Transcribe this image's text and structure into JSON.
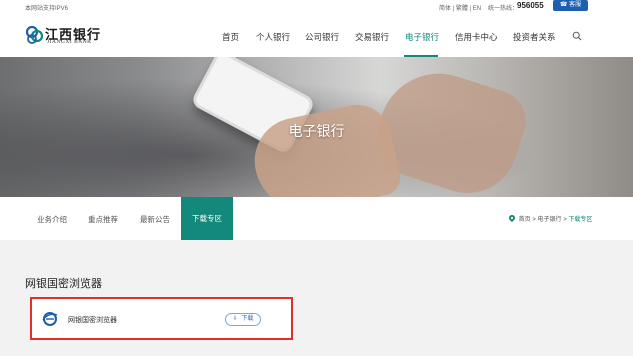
{
  "topbar": {
    "ipv6": "本网站支持IPV6",
    "lang": "简体 | 繁體 | EN",
    "hotline_label": "统一热线：",
    "hotline_number": "956055",
    "cs_label": "客服"
  },
  "logo": {
    "cn": "江西银行",
    "en": "JIANGXI BANK"
  },
  "nav": {
    "items": [
      {
        "label": "首页"
      },
      {
        "label": "个人银行"
      },
      {
        "label": "公司银行"
      },
      {
        "label": "交易银行"
      },
      {
        "label": "电子银行"
      },
      {
        "label": "信用卡中心"
      },
      {
        "label": "投资者关系"
      }
    ],
    "active": "电子银行",
    "icons": {
      "search": "search-icon"
    }
  },
  "hero": {
    "title": "电子银行"
  },
  "subnav": {
    "items": [
      {
        "label": "业务介绍"
      },
      {
        "label": "重点推荐"
      },
      {
        "label": "最新公告"
      },
      {
        "label": "下载专区"
      }
    ],
    "active": "下载专区"
  },
  "breadcrumb": {
    "home": "首页",
    "sep1": ">",
    "section": "电子银行",
    "sep2": ">",
    "current": "下载专区"
  },
  "content": {
    "section_title": "网银国密浏览器",
    "card": {
      "name": "网银国密浏览器",
      "download_label": "下载",
      "icon": "ie-browser-icon"
    }
  },
  "colors": {
    "accent": "#12897a",
    "highlight_border": "#e0302a",
    "button_blue": "#1f5fb0"
  }
}
